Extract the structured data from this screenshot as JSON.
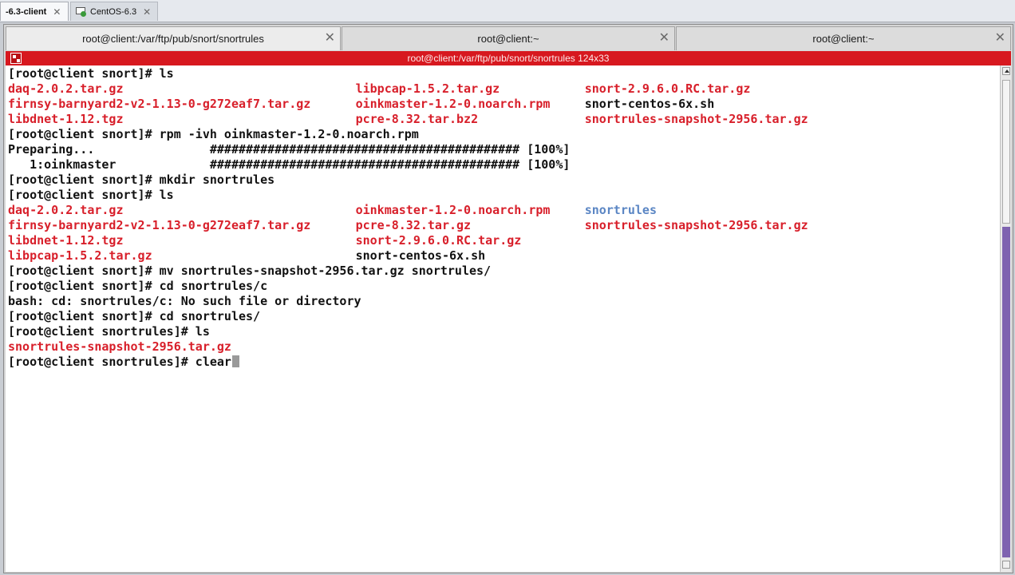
{
  "vm_tabs": [
    {
      "label": "-6.3-client",
      "active": true
    },
    {
      "label": "CentOS-6.3",
      "active": false
    }
  ],
  "konsole_tabs": [
    {
      "label": "root@client:/var/ftp/pub/snort/snortrules"
    },
    {
      "label": "root@client:~"
    },
    {
      "label": "root@client:~"
    }
  ],
  "titlebar": {
    "title": "root@client:/var/ftp/pub/snort/snortrules 124x33",
    "accent_color": "#d7181f"
  },
  "terminal": {
    "lines": [
      [
        {
          "col": 0,
          "text": "[root@client snort]# ls",
          "color": "default"
        }
      ],
      [
        {
          "col": 0,
          "text": "daq-2.0.2.tar.gz",
          "color": "red"
        },
        {
          "col": 44,
          "text": "libpcap-1.5.2.tar.gz",
          "color": "red"
        },
        {
          "col": 73,
          "text": "snort-2.9.6.0.RC.tar.gz",
          "color": "red"
        }
      ],
      [
        {
          "col": 0,
          "text": "firnsy-barnyard2-v2-1.13-0-g272eaf7.tar.gz",
          "color": "red"
        },
        {
          "col": 44,
          "text": "oinkmaster-1.2-0.noarch.rpm",
          "color": "red"
        },
        {
          "col": 73,
          "text": "snort-centos-6x.sh",
          "color": "default"
        }
      ],
      [
        {
          "col": 0,
          "text": "libdnet-1.12.tgz",
          "color": "red"
        },
        {
          "col": 44,
          "text": "pcre-8.32.tar.bz2",
          "color": "red"
        },
        {
          "col": 73,
          "text": "snortrules-snapshot-2956.tar.gz",
          "color": "red"
        }
      ],
      [
        {
          "col": 0,
          "text": "[root@client snort]# rpm -ivh oinkmaster-1.2-0.noarch.rpm",
          "color": "default"
        }
      ],
      [
        {
          "col": 0,
          "text": "Preparing...                ########################################### [100%]",
          "color": "default"
        }
      ],
      [
        {
          "col": 0,
          "text": "   1:oinkmaster             ########################################### [100%]",
          "color": "default"
        }
      ],
      [
        {
          "col": 0,
          "text": "[root@client snort]# mkdir snortrules",
          "color": "default"
        }
      ],
      [
        {
          "col": 0,
          "text": "[root@client snort]# ls",
          "color": "default"
        }
      ],
      [
        {
          "col": 0,
          "text": "daq-2.0.2.tar.gz",
          "color": "red"
        },
        {
          "col": 44,
          "text": "oinkmaster-1.2-0.noarch.rpm",
          "color": "red"
        },
        {
          "col": 73,
          "text": "snortrules",
          "color": "blue"
        }
      ],
      [
        {
          "col": 0,
          "text": "firnsy-barnyard2-v2-1.13-0-g272eaf7.tar.gz",
          "color": "red"
        },
        {
          "col": 44,
          "text": "pcre-8.32.tar.gz",
          "color": "red"
        },
        {
          "col": 73,
          "text": "snortrules-snapshot-2956.tar.gz",
          "color": "red"
        }
      ],
      [
        {
          "col": 0,
          "text": "libdnet-1.12.tgz",
          "color": "red"
        },
        {
          "col": 44,
          "text": "snort-2.9.6.0.RC.tar.gz",
          "color": "red"
        }
      ],
      [
        {
          "col": 0,
          "text": "libpcap-1.5.2.tar.gz",
          "color": "red"
        },
        {
          "col": 44,
          "text": "snort-centos-6x.sh",
          "color": "default"
        }
      ],
      [
        {
          "col": 0,
          "text": "[root@client snort]# mv snortrules-snapshot-2956.tar.gz snortrules/",
          "color": "default"
        }
      ],
      [
        {
          "col": 0,
          "text": "[root@client snort]# cd snortrules/c",
          "color": "default"
        }
      ],
      [
        {
          "col": 0,
          "text": "bash: cd: snortrules/c: No such file or directory",
          "color": "default"
        }
      ],
      [
        {
          "col": 0,
          "text": "[root@client snort]# cd snortrules/",
          "color": "default"
        }
      ],
      [
        {
          "col": 0,
          "text": "[root@client snortrules]# ls",
          "color": "default"
        }
      ],
      [
        {
          "col": 0,
          "text": "snortrules-snapshot-2956.tar.gz",
          "color": "red"
        }
      ],
      [
        {
          "col": 0,
          "text": "[root@client snortrules]# clear",
          "color": "default"
        }
      ]
    ],
    "colors": {
      "red": "#d81f2a",
      "blue": "#5b86c4",
      "default": "#111111"
    }
  }
}
